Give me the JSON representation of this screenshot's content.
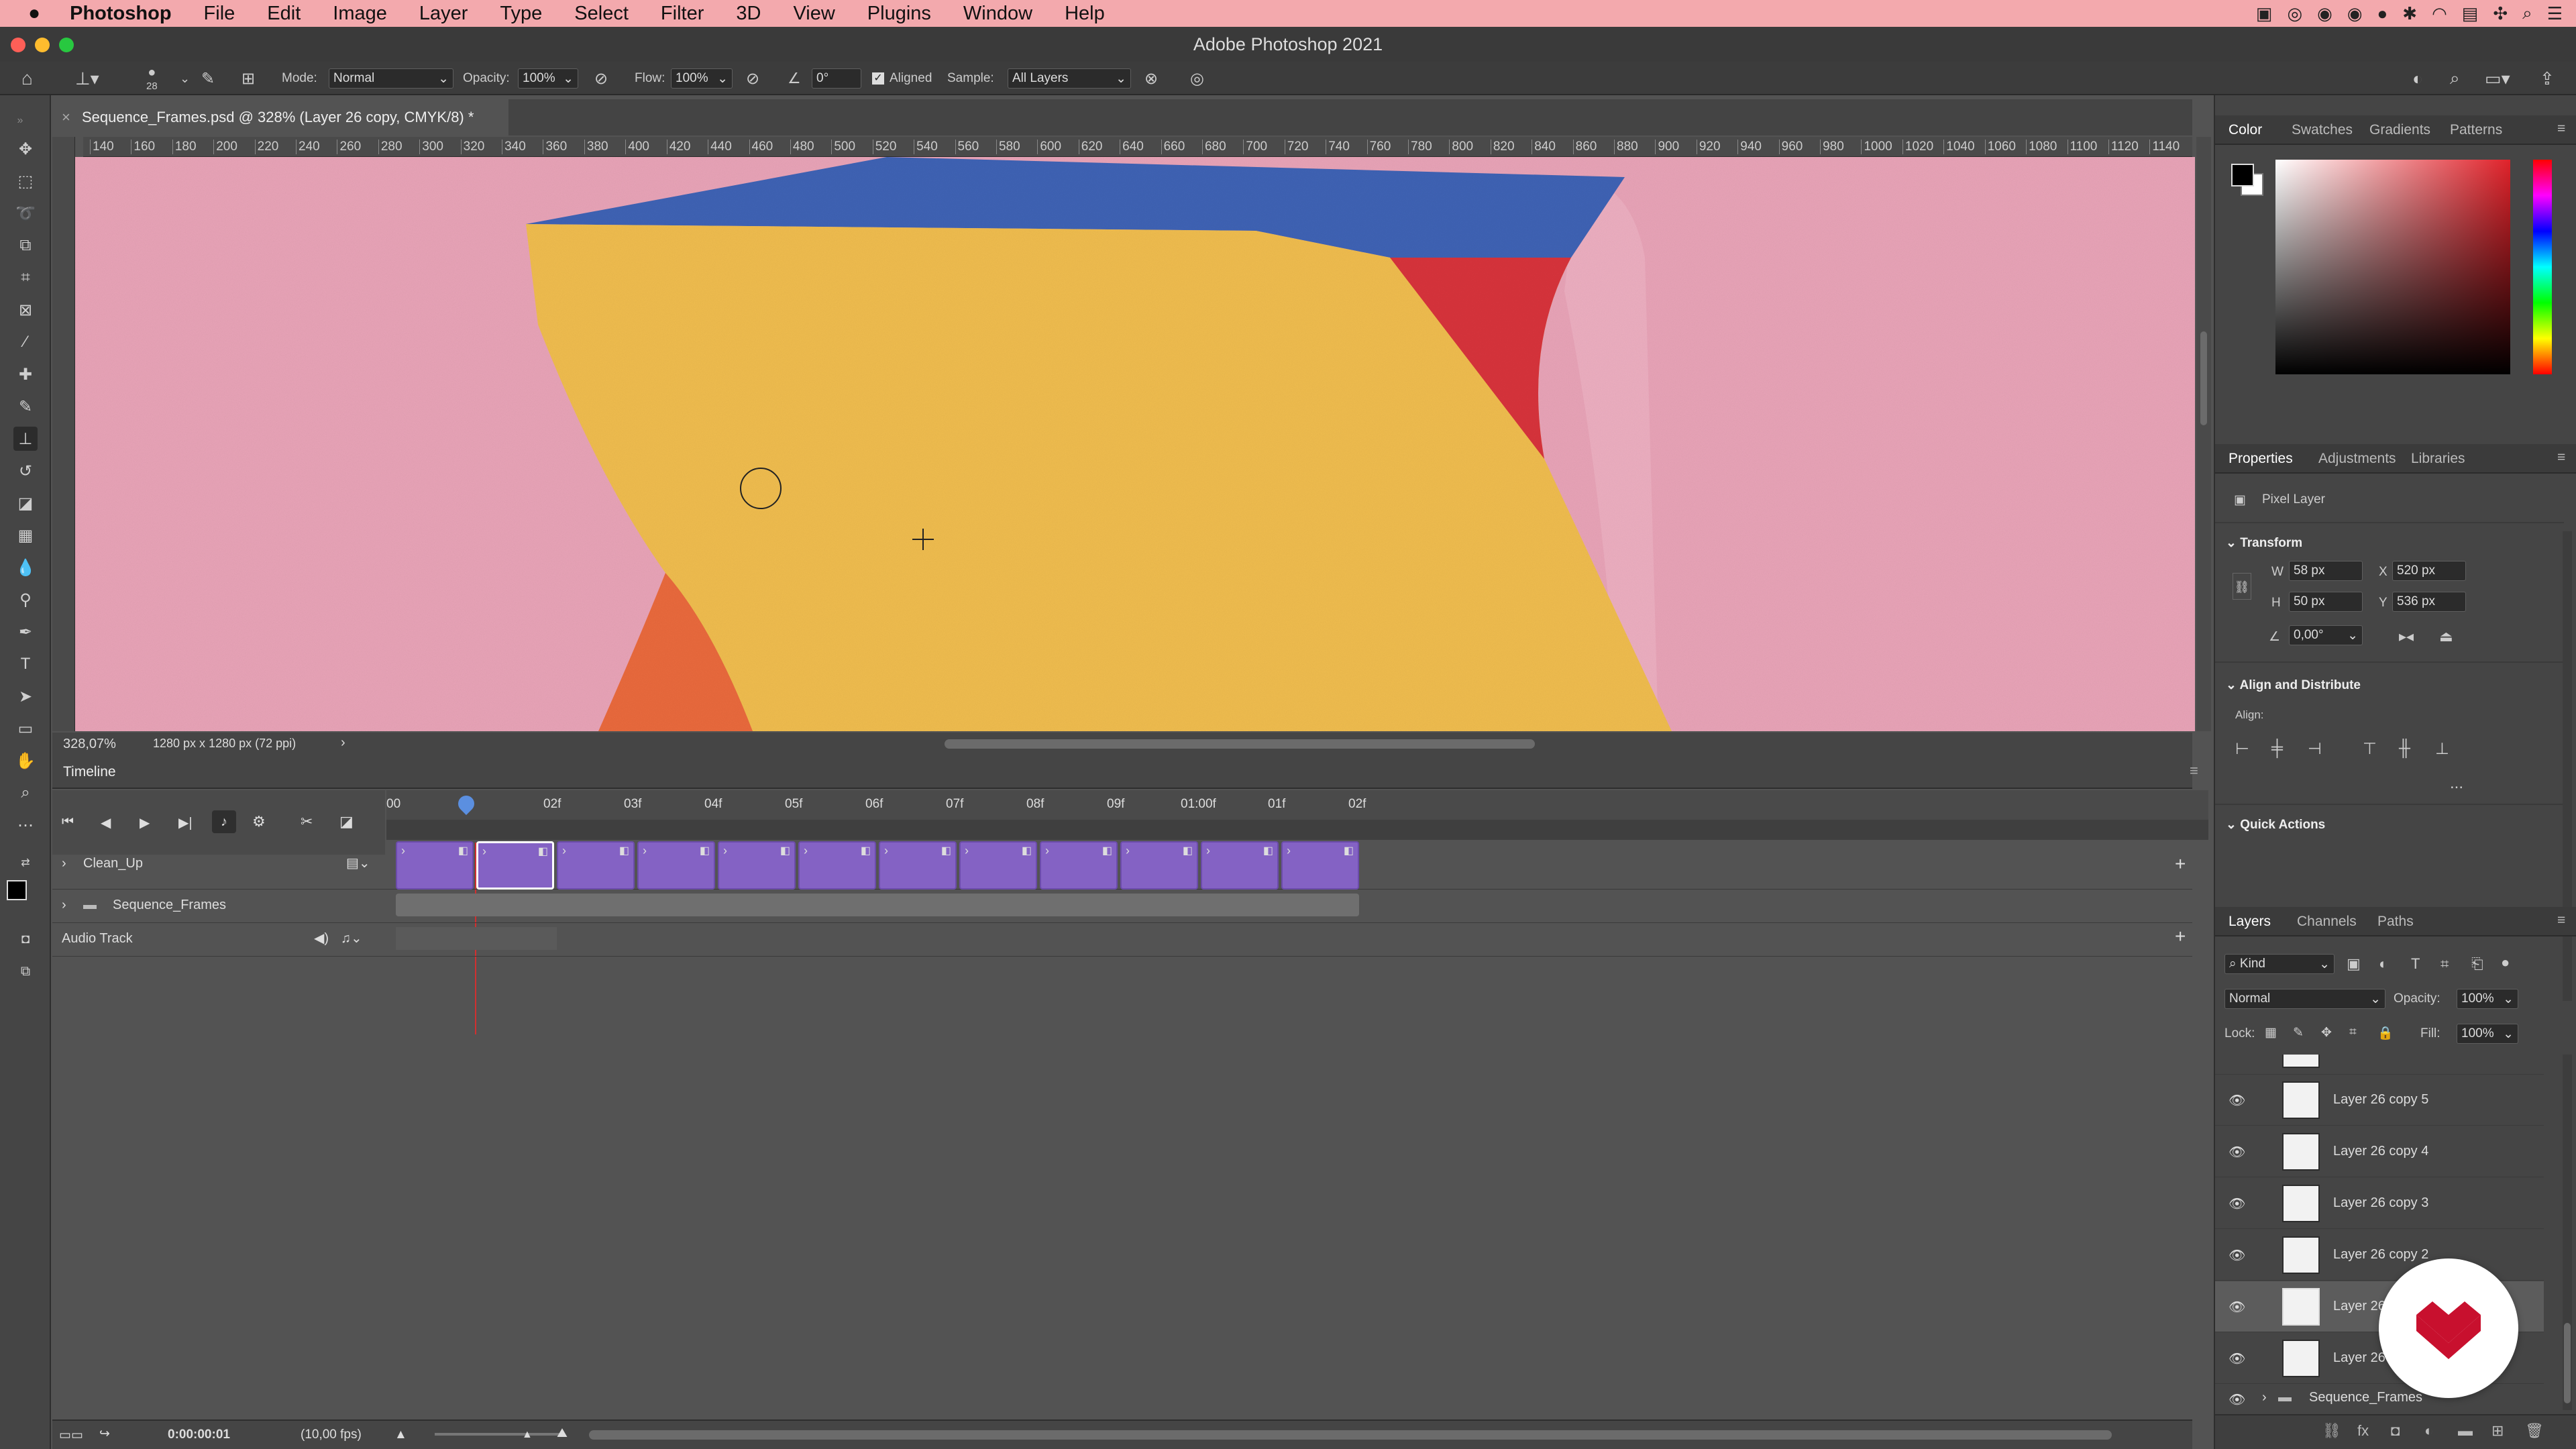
{
  "menubar": {
    "app": "Photoshop",
    "items": [
      "File",
      "Edit",
      "Image",
      "Layer",
      "Type",
      "Select",
      "Filter",
      "3D",
      "View",
      "Plugins",
      "Window",
      "Help"
    ]
  },
  "window": {
    "title": "Adobe Photoshop 2021"
  },
  "options": {
    "brush_size": "28",
    "mode_label": "Mode:",
    "mode_value": "Normal",
    "opacity_label": "Opacity:",
    "opacity_value": "100%",
    "flow_label": "Flow:",
    "flow_value": "100%",
    "angle_value": "0°",
    "aligned_label": "Aligned",
    "sample_label": "Sample:",
    "sample_value": "All Layers"
  },
  "document": {
    "tab_title": "Sequence_Frames.psd @ 328% (Layer 26 copy, CMYK/8) *",
    "ruler_ticks": [
      "140",
      "160",
      "180",
      "200",
      "220",
      "240",
      "260",
      "280",
      "300",
      "320",
      "340",
      "360",
      "380",
      "400",
      "420",
      "440",
      "460",
      "480",
      "500",
      "520",
      "540",
      "560",
      "580",
      "600",
      "620",
      "640",
      "660",
      "680",
      "700",
      "720",
      "740",
      "760",
      "780",
      "800",
      "820",
      "840",
      "860",
      "880",
      "900",
      "920",
      "940",
      "960",
      "980",
      "1000",
      "1020",
      "1040",
      "1060",
      "1080",
      "1100",
      "1120",
      "1140"
    ],
    "zoom": "328,07%",
    "size_info": "1280 px x 1280 px (72 ppi)"
  },
  "timeline": {
    "title": "Timeline",
    "time_ticks": [
      "00",
      "02f",
      "03f",
      "04f",
      "05f",
      "06f",
      "07f",
      "08f",
      "09f",
      "01:00f",
      "01f",
      "02f"
    ],
    "tracks": {
      "clean_up": "Clean_Up",
      "sequence_frames": "Sequence_Frames",
      "audio": "Audio Track"
    },
    "current_time": "0:00:00:01",
    "fps": "(10,00 fps)",
    "frame_count": 12,
    "selected_frame": 2
  },
  "color_panel": {
    "tabs": [
      "Color",
      "Swatches",
      "Gradients",
      "Patterns"
    ],
    "active": "Color"
  },
  "properties": {
    "tabs": [
      "Properties",
      "Adjustments",
      "Libraries"
    ],
    "layer_type": "Pixel Layer",
    "transform_title": "Transform",
    "w_label": "W",
    "w_value": "58 px",
    "h_label": "H",
    "h_value": "50 px",
    "x_label": "X",
    "x_value": "520 px",
    "y_label": "Y",
    "y_value": "536 px",
    "angle": "0,00°",
    "align_title": "Align and Distribute",
    "align_label": "Align:",
    "quick_actions": "Quick Actions",
    "more": "..."
  },
  "layers": {
    "tabs": [
      "Layers",
      "Channels",
      "Paths"
    ],
    "filter_kind": "Kind",
    "blend_mode": "Normal",
    "opacity_label": "Opacity:",
    "opacity_value": "100%",
    "lock_label": "Lock:",
    "fill_label": "Fill:",
    "fill_value": "100%",
    "items": [
      {
        "name": "Layer 26 copy 5"
      },
      {
        "name": "Layer 26 copy 4"
      },
      {
        "name": "Layer 26 copy 3"
      },
      {
        "name": "Layer 26 copy 2"
      },
      {
        "name": "Layer 26"
      },
      {
        "name": "Layer 26"
      }
    ],
    "group": "Sequence_Frames"
  },
  "colors": {
    "accent": "#8462c4",
    "watermark": "#c8102e",
    "menubar": "#f3a9ad"
  }
}
